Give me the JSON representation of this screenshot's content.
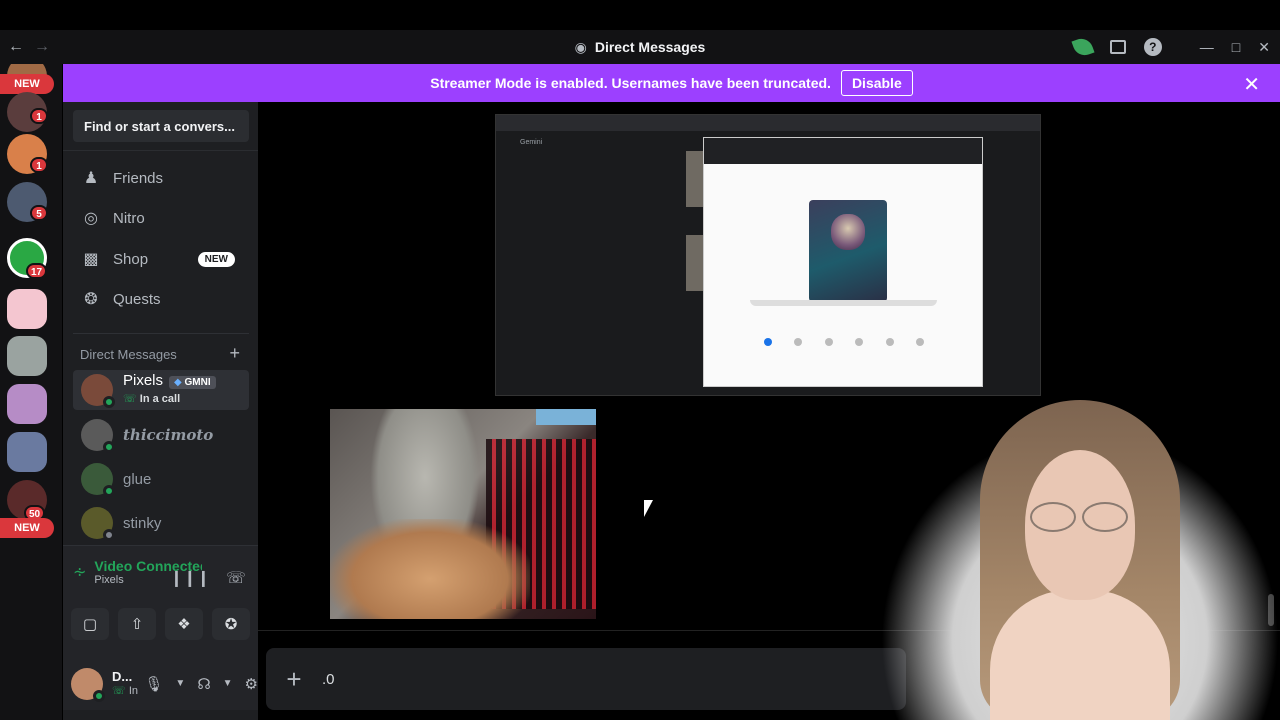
{
  "window": {
    "title": "Direct Messages",
    "back_icon": "arrow-left-icon",
    "forward_icon": "arrow-right-icon"
  },
  "rail": {
    "badges": [
      "1",
      "1",
      "5",
      "17",
      "50"
    ],
    "new_label": "NEW"
  },
  "banner": {
    "text": "Streamer Mode is enabled. Usernames have been truncated.",
    "button": "Disable",
    "color": "#9c40ff"
  },
  "sidebar": {
    "search_placeholder": "Find or start a convers...",
    "nav": [
      {
        "label": "Friends",
        "icon": "friends-icon"
      },
      {
        "label": "Nitro",
        "icon": "nitro-icon"
      },
      {
        "label": "Shop",
        "icon": "shop-icon",
        "badge": "NEW"
      },
      {
        "label": "Quests",
        "icon": "quests-icon"
      }
    ],
    "dm_header": "Direct Messages",
    "dms": [
      {
        "name": "Pixels",
        "tag": "GMNI",
        "status": "In a call"
      },
      {
        "name": "thiccimoto"
      },
      {
        "name": "glue"
      },
      {
        "name": "stinky"
      }
    ]
  },
  "voice": {
    "status": "Video Connected",
    "channel": "Pixels"
  },
  "user": {
    "name": "D...",
    "status": "In"
  },
  "screen_share": {
    "app": "Gemini"
  },
  "chat": {
    "input_value": ".0"
  },
  "colors": {
    "accent": "#9c40ff",
    "online": "#23a55a",
    "danger": "#da373c"
  }
}
